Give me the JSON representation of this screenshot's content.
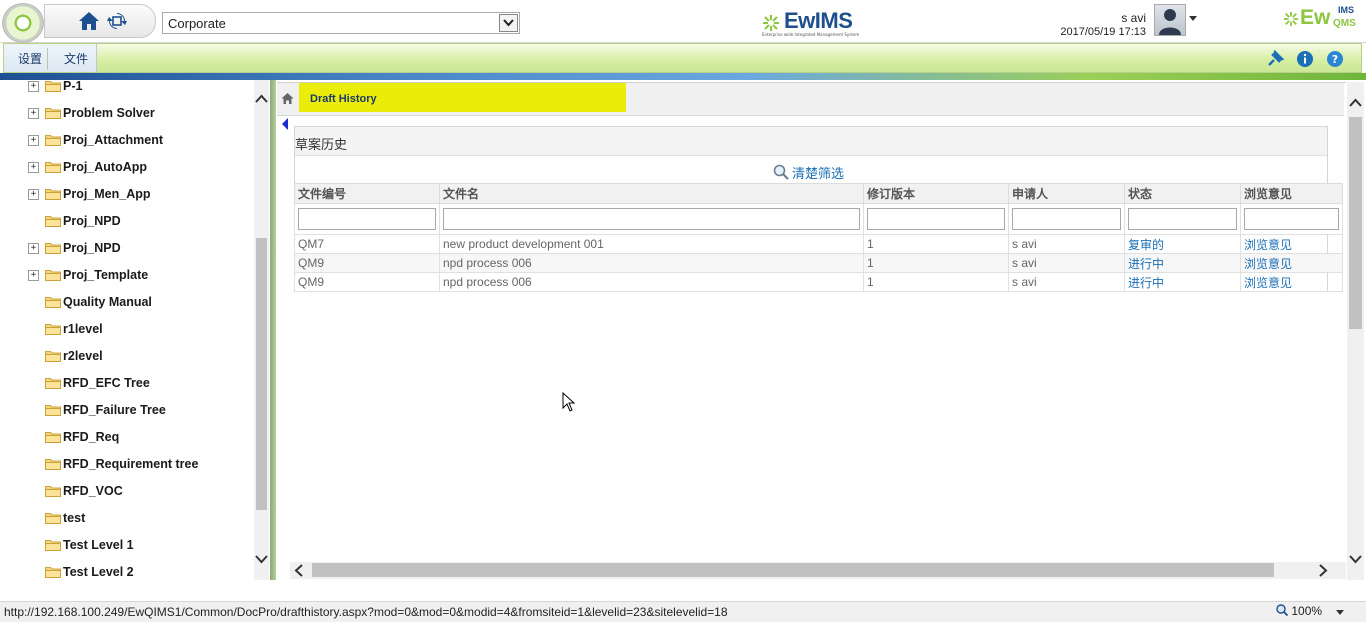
{
  "header": {
    "site_select_value": "Corporate",
    "center_logo_text": "EwIMS",
    "center_logo_tagline": "Enterprise wide Integrated Management System",
    "right_logo_text": "Ew",
    "right_logo_sup": "IMS",
    "right_logo_sub": "QMS",
    "user_name": "s avi",
    "datetime": "2017/05/19 17:13"
  },
  "menu": {
    "items": [
      "设置",
      "文件"
    ]
  },
  "tree": {
    "items": [
      {
        "label": "P-1",
        "expandable": true
      },
      {
        "label": "Problem Solver",
        "expandable": true
      },
      {
        "label": "Proj_Attachment",
        "expandable": true
      },
      {
        "label": "Proj_AutoApp",
        "expandable": true
      },
      {
        "label": "Proj_Men_App",
        "expandable": true
      },
      {
        "label": "Proj_NPD",
        "expandable": false
      },
      {
        "label": "Proj_NPD",
        "expandable": true
      },
      {
        "label": "Proj_Template",
        "expandable": true
      },
      {
        "label": "Quality Manual",
        "expandable": false
      },
      {
        "label": "r1level",
        "expandable": false
      },
      {
        "label": "r2level",
        "expandable": false
      },
      {
        "label": "RFD_EFC Tree",
        "expandable": false
      },
      {
        "label": "RFD_Failure Tree",
        "expandable": false
      },
      {
        "label": "RFD_Req",
        "expandable": false
      },
      {
        "label": "RFD_Requirement tree",
        "expandable": false
      },
      {
        "label": "RFD_VOC",
        "expandable": false
      },
      {
        "label": "test",
        "expandable": false
      },
      {
        "label": "Test Level 1",
        "expandable": false
      },
      {
        "label": "Test Level 2",
        "expandable": false
      }
    ]
  },
  "breadcrumb": {
    "title": "Draft History"
  },
  "panel": {
    "title": "草案历史",
    "clear_filter_label": "清楚筛选"
  },
  "grid": {
    "columns": [
      "文件编号",
      "文件名",
      "修订版本",
      "申请人",
      "状态",
      "浏览意见"
    ],
    "rows": [
      [
        "QM7",
        "new product development 001",
        "1",
        "s avi",
        "复审的",
        "浏览意见"
      ],
      [
        "QM9",
        "npd process 006",
        "1",
        "s avi",
        "进行中",
        "浏览意见"
      ],
      [
        "QM9",
        "npd process 006",
        "1",
        "s avi",
        "进行中",
        "浏览意见"
      ]
    ]
  },
  "statusbar": {
    "url": "http://192.168.100.249/EwQIMS1/Common/DocPro/drafthistory.aspx?mod=0&mod=0&modid=4&fromsiteid=1&levelid=23&sitelevelid=18",
    "zoom": "100%"
  },
  "colors": {
    "accent_green": "#8cc63f",
    "highlight_yellow": "#ecec0a",
    "link_blue": "#1a6fb5",
    "brand_blue": "#1e4f8e"
  }
}
